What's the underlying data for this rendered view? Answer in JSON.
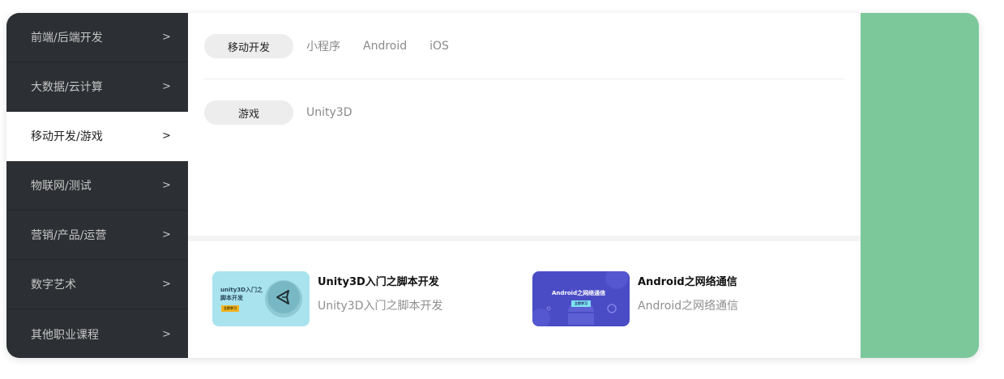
{
  "sidebar": {
    "items": [
      {
        "label": "前端/后端开发",
        "arrow": ">"
      },
      {
        "label": "大数据/云计算",
        "arrow": ">"
      },
      {
        "label": "移动开发/游戏",
        "arrow": ">"
      },
      {
        "label": "物联网/测试",
        "arrow": ">"
      },
      {
        "label": "营销/产品/运营",
        "arrow": ">"
      },
      {
        "label": "数字艺术",
        "arrow": ">"
      },
      {
        "label": "其他职业课程",
        "arrow": ">"
      }
    ],
    "active_index": 2
  },
  "categories": [
    {
      "pill": "移动开发",
      "tags": [
        "小程序",
        "Android",
        "iOS"
      ]
    },
    {
      "pill": "游戏",
      "tags": [
        "Unity3D"
      ]
    }
  ],
  "courses": [
    {
      "title": "Unity3D入门之脚本开发",
      "subtitle": "Unity3D入门之脚本开发",
      "thumb_text_1": "unity3D入门之",
      "thumb_text_2": "脚本开发",
      "thumb_badge": "立即学习",
      "icon": "unity-logo-icon",
      "thumb_color": "#a9e3ee"
    },
    {
      "title": "Android之网络通信",
      "subtitle": "Android之网络通信",
      "thumb_text_1": "Android之网络通信",
      "thumb_badge": "立即学习",
      "icon": "android-robot-icon",
      "thumb_color": "#4a4cc6"
    }
  ],
  "colors": {
    "sidebar_bg": "#2c2f33",
    "accent_green": "#7cc89b",
    "pill_bg": "#ededed"
  }
}
